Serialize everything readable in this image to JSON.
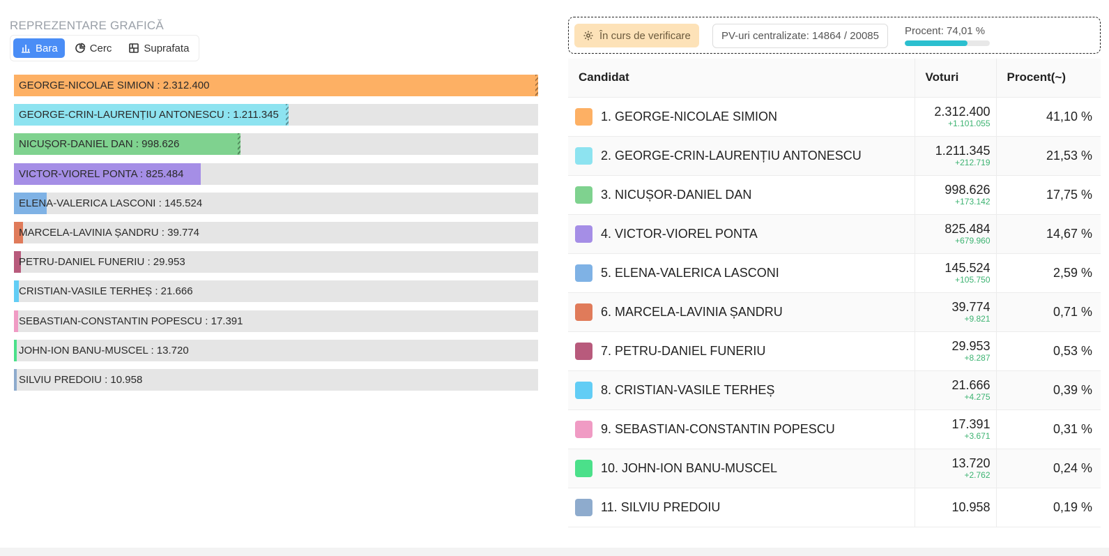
{
  "section_title": "REPREZENTARE GRAFICĂ",
  "chart_mode_tabs": [
    {
      "label": "Bara",
      "icon": "bar-chart-icon",
      "active": true
    },
    {
      "label": "Cerc",
      "icon": "pie-chart-icon",
      "active": false
    },
    {
      "label": "Suprafata",
      "icon": "area-chart-icon",
      "active": false
    }
  ],
  "status": {
    "badge_label": "În curs de verificare",
    "pv_label": "PV-uri centralizate: 14864 / 20085",
    "percent_label": "Procent: 74,01 %",
    "percent_value": 74.01
  },
  "table_headers": {
    "candidate": "Candidat",
    "votes": "Voturi",
    "percent": "Procent(~)"
  },
  "chart_data": {
    "type": "bar",
    "orientation": "horizontal",
    "categories": [
      "GEORGE-NICOLAE SIMION",
      "GEORGE-CRIN-LAURENȚIU ANTONESCU",
      "NICUȘOR-DANIEL DAN",
      "VICTOR-VIOREL PONTA",
      "ELENA-VALERICA LASCONI",
      "MARCELA-LAVINIA ȘANDRU",
      "PETRU-DANIEL FUNERIU",
      "CRISTIAN-VASILE TERHEȘ",
      "SEBASTIAN-CONSTANTIN POPESCU",
      "JOHN-ION BANU-MUSCEL",
      "SILVIU PREDOIU"
    ],
    "values": [
      2312400,
      1211345,
      998626,
      825484,
      145524,
      39774,
      29953,
      21666,
      17391,
      13720,
      10958
    ],
    "xlim": [
      0,
      2312400
    ]
  },
  "candidates": [
    {
      "rank": "1.",
      "name": "GEORGE-NICOLAE SIMION",
      "bar_label": "GEORGE-NICOLAE SIMION : 2.312.400",
      "votes": "2.312.400",
      "delta": "+1.101.055",
      "percent": "41,10 %",
      "color": "#fdb064",
      "hatched": true
    },
    {
      "rank": "2.",
      "name": "GEORGE-CRIN-LAURENȚIU ANTONESCU",
      "bar_label": "GEORGE-CRIN-LAURENȚIU ANTONESCU : 1.211.345",
      "votes": "1.211.345",
      "delta": "+212.719",
      "percent": "21,53 %",
      "color": "#8de3f0",
      "hatched": true
    },
    {
      "rank": "3.",
      "name": "NICUȘOR-DANIEL DAN",
      "bar_label": "NICUȘOR-DANIEL DAN : 998.626",
      "votes": "998.626",
      "delta": "+173.142",
      "percent": "17,75 %",
      "color": "#7fd28f",
      "hatched": true
    },
    {
      "rank": "4.",
      "name": "VICTOR-VIOREL PONTA",
      "bar_label": "VICTOR-VIOREL PONTA : 825.484",
      "votes": "825.484",
      "delta": "+679.960",
      "percent": "14,67 %",
      "color": "#a58ee6",
      "hatched": false
    },
    {
      "rank": "5.",
      "name": "ELENA-VALERICA LASCONI",
      "bar_label": "ELENA-VALERICA LASCONI : 145.524",
      "votes": "145.524",
      "delta": "+105.750",
      "percent": "2,59 %",
      "color": "#7fb2e5",
      "hatched": false
    },
    {
      "rank": "6.",
      "name": "MARCELA-LAVINIA ȘANDRU",
      "bar_label": "MARCELA-LAVINIA ȘANDRU : 39.774",
      "votes": "39.774",
      "delta": "+9.821",
      "percent": "0,71 %",
      "color": "#e07b5a",
      "hatched": false
    },
    {
      "rank": "7.",
      "name": "PETRU-DANIEL FUNERIU",
      "bar_label": "PETRU-DANIEL FUNERIU : 29.953",
      "votes": "29.953",
      "delta": "+8.287",
      "percent": "0,53 %",
      "color": "#b85a7c",
      "hatched": false
    },
    {
      "rank": "8.",
      "name": "CRISTIAN-VASILE TERHEȘ",
      "bar_label": "CRISTIAN-VASILE TERHEȘ : 21.666",
      "votes": "21.666",
      "delta": "+4.275",
      "percent": "0,39 %",
      "color": "#62cdf5",
      "hatched": false
    },
    {
      "rank": "9.",
      "name": "SEBASTIAN-CONSTANTIN POPESCU",
      "bar_label": "SEBASTIAN-CONSTANTIN POPESCU : 17.391",
      "votes": "17.391",
      "delta": "+3.671",
      "percent": "0,31 %",
      "color": "#f09bc4",
      "hatched": false
    },
    {
      "rank": "10.",
      "name": "JOHN-ION BANU-MUSCEL",
      "bar_label": "JOHN-ION BANU-MUSCEL : 13.720",
      "votes": "13.720",
      "delta": "+2.762",
      "percent": "0,24 %",
      "color": "#4be08a",
      "hatched": false
    },
    {
      "rank": "11.",
      "name": "SILVIU PREDOIU",
      "bar_label": "SILVIU PREDOIU : 10.958",
      "votes": "10.958",
      "delta": "",
      "percent": "0,19 %",
      "color": "#8eabcd",
      "hatched": false
    }
  ]
}
